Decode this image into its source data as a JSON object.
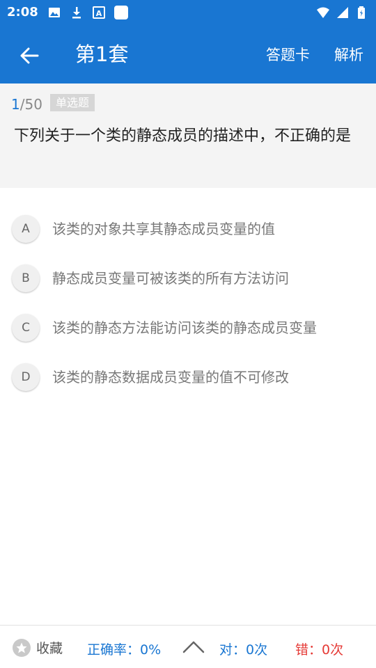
{
  "status_bar": {
    "time": "2:08",
    "left_icons": [
      "image-icon",
      "download-icon",
      "font-icon",
      "square-icon"
    ],
    "right_icons": [
      "wifi-icon",
      "signal-icon",
      "battery-icon"
    ]
  },
  "app_bar": {
    "title": "第1套",
    "actions": {
      "answer_card": "答题卡",
      "analysis": "解析"
    }
  },
  "question": {
    "current": "1",
    "separator_total": "/50",
    "type": "单选题",
    "text": "下列关于一个类的静态成员的描述中，不正确的是"
  },
  "options": [
    {
      "letter": "A",
      "text": "该类的对象共享其静态成员变量的值"
    },
    {
      "letter": "B",
      "text": "静态成员变量可被该类的所有方法访问"
    },
    {
      "letter": "C",
      "text": "该类的静态方法能访问该类的静态成员变量"
    },
    {
      "letter": "D",
      "text": "该类的静态数据成员变量的值不可修改"
    }
  ],
  "bottom_bar": {
    "favorite_label": "收藏",
    "accuracy": "正确率：0%",
    "correct": "对：0次",
    "wrong": "错：0次"
  },
  "colors": {
    "primary": "#1976d2",
    "error": "#e53935",
    "panel_bg": "#f4f4f4"
  }
}
